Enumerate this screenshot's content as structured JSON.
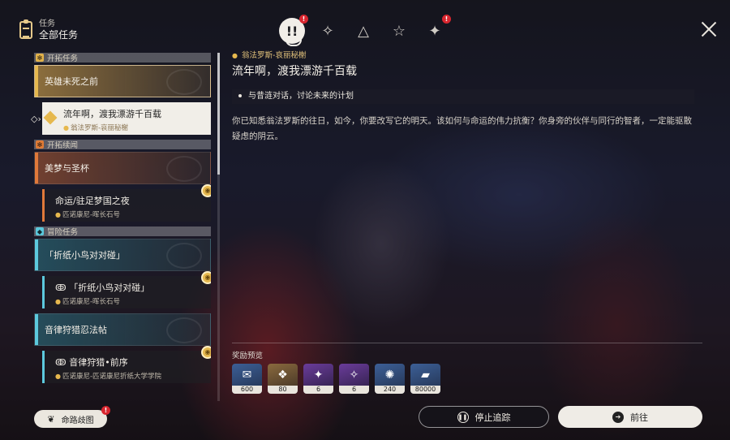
{
  "header": {
    "subtitle": "任务",
    "title": "全部任务"
  },
  "tabs": [
    {
      "icon": "exclamation-icon",
      "glyph": "!!",
      "active": true,
      "badge": "!"
    },
    {
      "icon": "compass-star-icon",
      "glyph": "✧",
      "active": false
    },
    {
      "icon": "triangle-icon",
      "glyph": "△",
      "active": false
    },
    {
      "icon": "star-icon",
      "glyph": "☆",
      "active": false
    },
    {
      "icon": "diamond-icon",
      "glyph": "✦",
      "active": false,
      "badge": "!"
    }
  ],
  "sidebar": {
    "sections": [
      {
        "label": "开拓任务",
        "color": "#e2b24a"
      },
      {
        "label": "开拓续闻",
        "color": "#e07b35"
      },
      {
        "label": "冒险任务",
        "color": "#5ac8dc"
      }
    ],
    "items": [
      {
        "label": "英雄未死之前"
      },
      {
        "label": "流年啊，渡我漂游千百载",
        "location": "翁法罗斯-哀丽秘榭"
      },
      {
        "label": "美梦与圣杯"
      },
      {
        "label": "命运/驻足梦国之夜",
        "location": "匹诺康尼-晖长石号"
      },
      {
        "label": "「折纸小鸟对对碰」"
      },
      {
        "label": "「折纸小鸟对对碰」",
        "location": "匹诺康尼-晖长石号"
      },
      {
        "label": "音律狩猎忍法帖"
      },
      {
        "label": "音律狩猎•前序",
        "location": "匹诺康尼-匹诺康尼折纸大学学院"
      }
    ]
  },
  "detail": {
    "location": "翁法罗斯-哀丽秘榭",
    "title": "流年啊，渡我漂游千百载",
    "objective": "与昔涟对话，讨论未来的计划",
    "description": "你已知悉翁法罗斯的往日，如今，你要改写它的明天。该如何与命运的伟力抗衡？你身旁的伙伴与同行的智者，一定能驱散疑虑的阴云。"
  },
  "rewards": {
    "title": "奖励预览",
    "items": [
      {
        "icon": "trailblaze-exp-icon",
        "amount": "600",
        "color": "#3c5f96"
      },
      {
        "icon": "crystal-icon",
        "amount": "80",
        "color": "#8a6a3e"
      },
      {
        "icon": "purple-material-icon",
        "amount": "6",
        "color": "#6a3c9a"
      },
      {
        "icon": "shards-material-icon",
        "amount": "6",
        "color": "#6a3c9a"
      },
      {
        "icon": "blue-fuel-icon",
        "amount": "240",
        "color": "#3c5f96"
      },
      {
        "icon": "credit-icon",
        "amount": "80000",
        "color": "#3c5f96"
      }
    ]
  },
  "buttons": {
    "stop_tracking": "停止追踪",
    "go": "前往",
    "map": "命路歧图",
    "map_badge": "!"
  }
}
